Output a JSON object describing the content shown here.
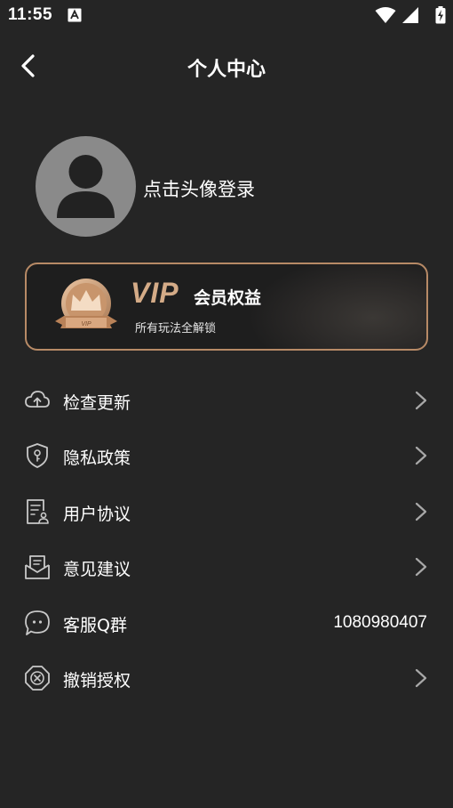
{
  "status_bar": {
    "time": "11:55",
    "icons": [
      "notification-a-icon",
      "wifi-icon",
      "signal-icon",
      "battery-charging-icon"
    ]
  },
  "header": {
    "title": "个人中心",
    "back_icon": "chevron-left-icon"
  },
  "profile": {
    "login_prompt": "点击头像登录",
    "avatar_icon": "user-silhouette-icon"
  },
  "vip_card": {
    "badge_text": "VIP",
    "title_vip": "VIP",
    "title": "会员权益",
    "subtitle": "所有玩法全解锁",
    "accent_color": "#b78a66"
  },
  "menu": [
    {
      "label": "检查更新",
      "icon": "cloud-upload-icon",
      "has_arrow": true
    },
    {
      "label": "隐私政策",
      "icon": "shield-key-icon",
      "has_arrow": true
    },
    {
      "label": "用户协议",
      "icon": "document-user-icon",
      "has_arrow": true
    },
    {
      "label": "意见建议",
      "icon": "mail-open-icon",
      "has_arrow": true
    },
    {
      "label": "客服Q群",
      "icon": "chat-bubble-icon",
      "value": "1080980407",
      "has_arrow": false
    },
    {
      "label": "撤销授权",
      "icon": "revoke-octagon-icon",
      "has_arrow": true
    }
  ],
  "colors": {
    "background": "#252525",
    "text": "#ffffff",
    "icon": "#c8c8c8",
    "avatar_bg": "#8a8a8a"
  }
}
